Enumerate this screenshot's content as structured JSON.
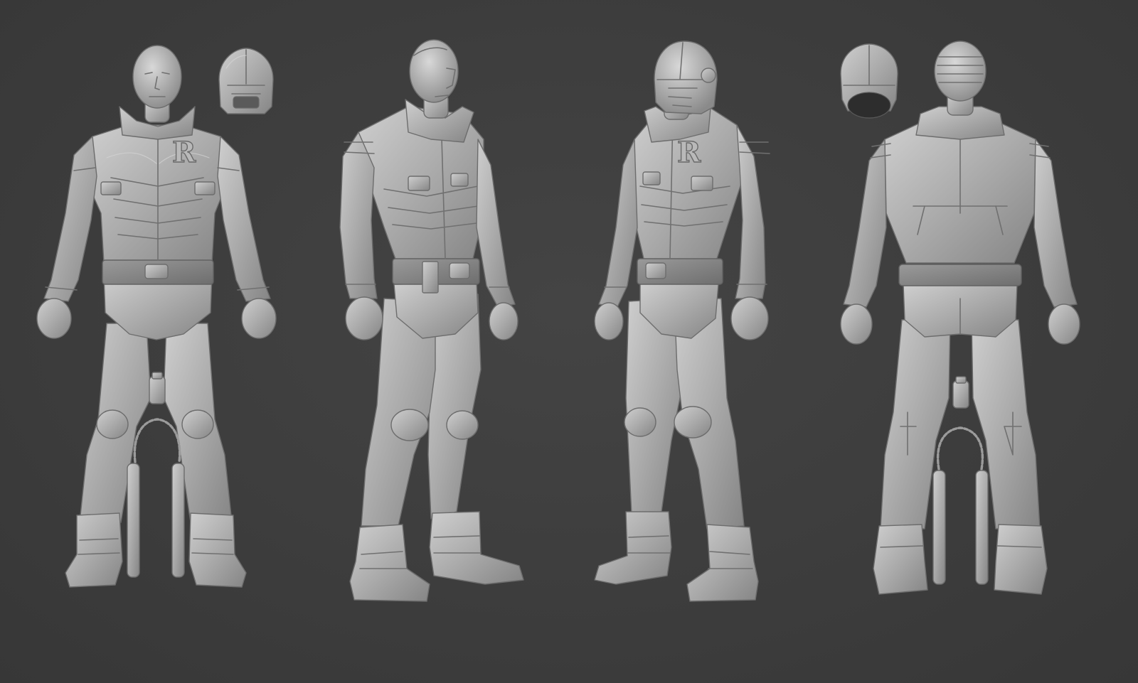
{
  "scene": {
    "background_color": "#3c3c3c",
    "clay_color": "#a8a8a8",
    "views": [
      {
        "name": "front-view",
        "emblem": "R"
      },
      {
        "name": "three-quarter-left-view",
        "emblem": ""
      },
      {
        "name": "three-quarter-right-view",
        "emblem": "R"
      },
      {
        "name": "back-view",
        "emblem": ""
      }
    ],
    "props": [
      "helmet",
      "canister",
      "nunchucks"
    ]
  }
}
